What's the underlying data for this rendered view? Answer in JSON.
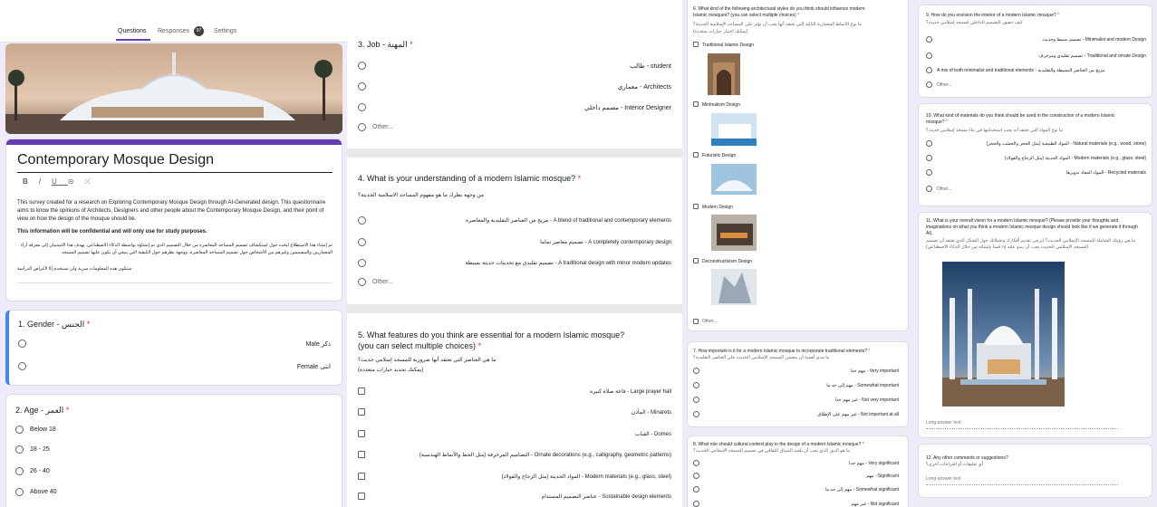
{
  "tabs": {
    "questions": "Questions",
    "responses": "Responses",
    "responses_count": "97",
    "settings": "Settings"
  },
  "form": {
    "title": "Contemporary Mosque Design",
    "toolbar": [
      "B",
      "I",
      "U",
      "⊝",
      "⤫"
    ],
    "desc1": "This survey created for a research on Exploring Contemporary Mosque Design through AI-Generated design. This questionnaire aims to know the opinions of Architects, Designers and other people about the Contemporary Mosque Design, and their point of view on how the design of the mosque should be.",
    "desc2": "This information will be confidential and will only use for study purposes.",
    "desc_ar1": "تم إنشاء هذا الاستطلاع لبحث حول استكشاف تصميم المساجد المعاصرة من خلال التصميم الذي تم إنشاؤه بواسطة الذكاء الاصطناعي. يهدف هذا الاستبيان إلى معرفة آراء المعماريين والمصممين وغيرهم من الأشخاص حول تصميم المساجد المعاصرة، ووجهة نظرهم حول الكيفية التي ينبغي أن يكون عليها تصميم المسجد",
    "desc_ar2": "ستكون هذه المعلومات سرية ولن تستخدم إلا لأغراض الدراسة"
  },
  "q1": {
    "title": "1. Gender - الجنس",
    "options": [
      "Male ذكر",
      "Female انثى"
    ]
  },
  "q2": {
    "title": "2. Age - العمر",
    "options": [
      "Below 18",
      "18 - 25",
      "26 - 40",
      "Above 40"
    ]
  },
  "q3": {
    "title": "3. Job - المهنة",
    "options": [
      "طالب - student",
      "معماري - Architects",
      "مصمم داخلي - Interior Designer"
    ],
    "other": "Other..."
  },
  "q4": {
    "title": "4. What is your understanding of a modern Islamic mosque?",
    "title_ar": "من وجهة نظرك ما هو مفهوم المساجد الاسلامية الحديثة؟",
    "options": [
      "مزيج من العناصر التقليدية والمعاصرة - A blend of traditional and contemporary elements",
      "تصميم معاصر تماما - A completely contemporary design",
      "تصميم تقليدي مع تحديثات حديثة بسيطة - A traditional design with minor modern updates"
    ],
    "other": "Other..."
  },
  "q5": {
    "title": "5. What features do you think are essential for a modern Islamic mosque? (you can select multiple choices)",
    "title_ar": "ما هي العناصر التي تعتقد أنها ضرورية للمسجد إسلامي حديث؟",
    "title_ar2": "(يمكنك تحديد خيارات متعددة)",
    "options": [
      "قاعة صلاة كبيرة - Large prayer hall",
      "المآذن - Minarets",
      "القباب - Domes",
      "التصاميم المزخرفة (مثل الخط والأنماط الهندسية) - Ornate decorations (e.g., calligraphy, geometric patterns)",
      "المواد الحديثة (مثل الزجاج والفولاذ) - Modern materials (e.g., glass, steel)",
      "عناصر التصميم المستدام - Sustainable design elements"
    ]
  },
  "q6": {
    "title": "6. What kind of the following architectural styles do you think should influence modern Islamic mosques? (you can select multiple choices)",
    "title_ar": "ما نوع الأنماط المعمارية التالية التي تعتقد أنها يجب أن تؤثر على المساجد الإسلامية الحديثة؟",
    "title_ar2": "(يمكنك اختيار خيارات متعددة)",
    "options": [
      "Traditional Islamic Design",
      "Minimalism Design",
      "Futuristic Design",
      "Modern Design",
      "Deconstructivism Design"
    ],
    "other": "Other..."
  },
  "q7": {
    "title": "7. How important is it for a modern Islamic mosque to incorporate traditional elements?",
    "title_ar": "ما مدى أهمية أن يتضمن المسجد الإسلامي الحديث على العناصر التقليدية؟",
    "options": [
      "مهم جدا - Very important",
      "مهم إلى حد ما - Somewhat important",
      "غير مهم جدا - Not very important",
      "غير مهم على الإطلاق - Not important at all"
    ]
  },
  "q8": {
    "title": "8. What role should cultural context play in the design of a modern Islamic mosque?",
    "title_ar": "ما هو الدور الذي يجب أن يلعبه السياق الثقافي في تصميم المسجد الإسلامي الحديث؟",
    "options": [
      "مهم جدا - Very significant",
      "مهم - Significant",
      "مهم إلى حد ما - Somewhat significant",
      "غير مهم - Not significant"
    ]
  },
  "q9": {
    "title": "9. How do you envision the interior of a modern Islamic mosque?",
    "title_ar": "كيف تتصور التصميم الداخلي لمسجد إسلامي حديث؟",
    "options": [
      "تصميم بسيط وحديث - Minimalist and modern Design",
      "تصميم تقليدي ومزخرف - Traditional and ornate Design",
      "A mix of both minimalist and traditional elements - مزيج من العناصر البسيطة والتقليدية"
    ],
    "other": "Other..."
  },
  "q10": {
    "title": "10. What kind of materials do you think should be used in the construction of a modern Islamic mosque?",
    "title_ar": "ما نوع المواد التي تعتقد أنه يجب استخدامها في بناء مسجد إسلامي حديث؟",
    "options": [
      "المواد الطبيعية (مثل الحجر والخشب والحجر) - Natural materials (e.g., wood, stone)",
      "المواد الحديثة (مثل الزجاج والفولاذ) - Modern materials (e.g., glass, steel)",
      "المواد المعاد تدويرها - Recycled materials"
    ],
    "other": "Other..."
  },
  "q11": {
    "title": "11. What is your overall vision for a modern Islamic mosque? (Please provide your thoughts and imaginations on what you think a modern Islamic mosque design should look like if we generate it through AI).",
    "title_ar": "ما هي رؤيتك الشاملة للمسجد الإسلامي الحديث؟ (يرجى تقديم أفكارك وتخيلاتك حول الشكل الذي تعتقد أن تصميم المسجد الإسلامي الحديث يجب أن يبدو عليه إذا قمنا بإنشائه من خلال الذكاء الاصطناعي)",
    "answer": "Long-answer text"
  },
  "q12": {
    "title": "12. Any other comments or suggestions?",
    "title_ar": "أي تعليقات أو اقتراحات أخرى؟",
    "answer": "Long-answer text"
  },
  "colors": {
    "accent": "#673ab7",
    "selected": "#4285f4",
    "required": "#d93025",
    "bg": "#f0ebf8"
  }
}
